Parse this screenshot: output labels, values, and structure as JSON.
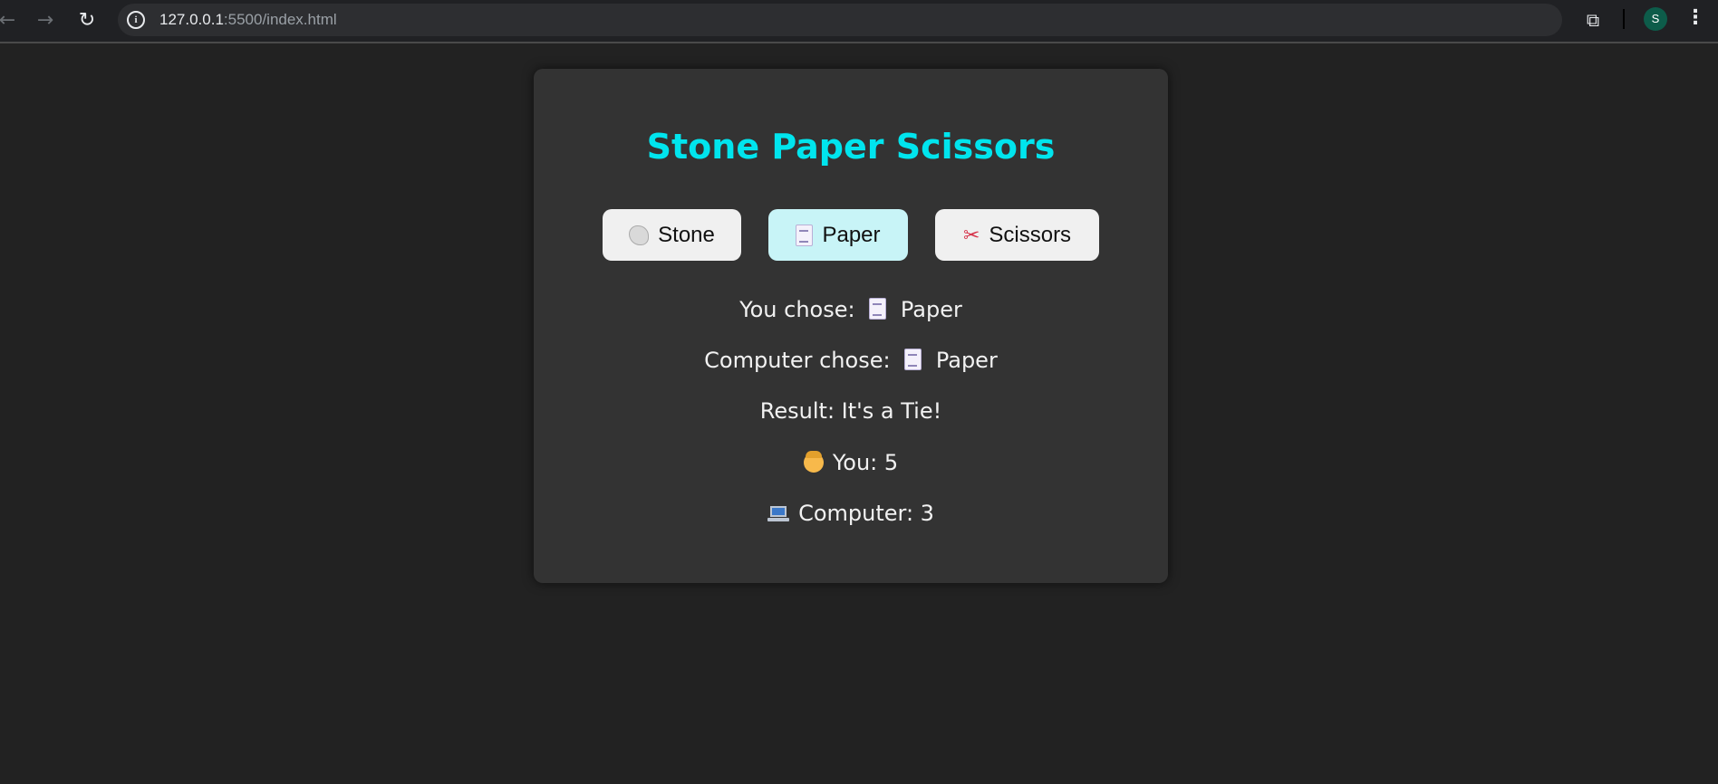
{
  "browser": {
    "url_host": "127.0.0.1",
    "url_path": ":5500/index.html",
    "profile_initial": "S",
    "icons": {
      "back": "arrow-left-icon",
      "forward": "arrow-right-icon",
      "reload": "reload-icon",
      "info": "info-icon",
      "bookmark": "star-icon",
      "extensions": "puzzle-icon",
      "menu": "kebab-menu-icon"
    }
  },
  "game": {
    "title": "Stone Paper Scissors",
    "choices": [
      {
        "label": "Stone",
        "icon": "rock-emoji-icon",
        "selected": false
      },
      {
        "label": "Paper",
        "icon": "page-emoji-icon",
        "selected": true
      },
      {
        "label": "Scissors",
        "icon": "scissors-emoji-icon",
        "selected": false
      }
    ],
    "you_chose_label": "You chose:",
    "you_chose_value": "Paper",
    "computer_chose_label": "Computer chose:",
    "computer_chose_value": "Paper",
    "result_text": "Result: It's a Tie!",
    "score_you_text": "You: 5",
    "score_computer_text": "Computer: 3",
    "colors": {
      "title": "#00e5ee",
      "selected_button": "#c8f4f7",
      "button": "#f0f0f0",
      "card": "#333333",
      "page_background": "#222222"
    }
  }
}
